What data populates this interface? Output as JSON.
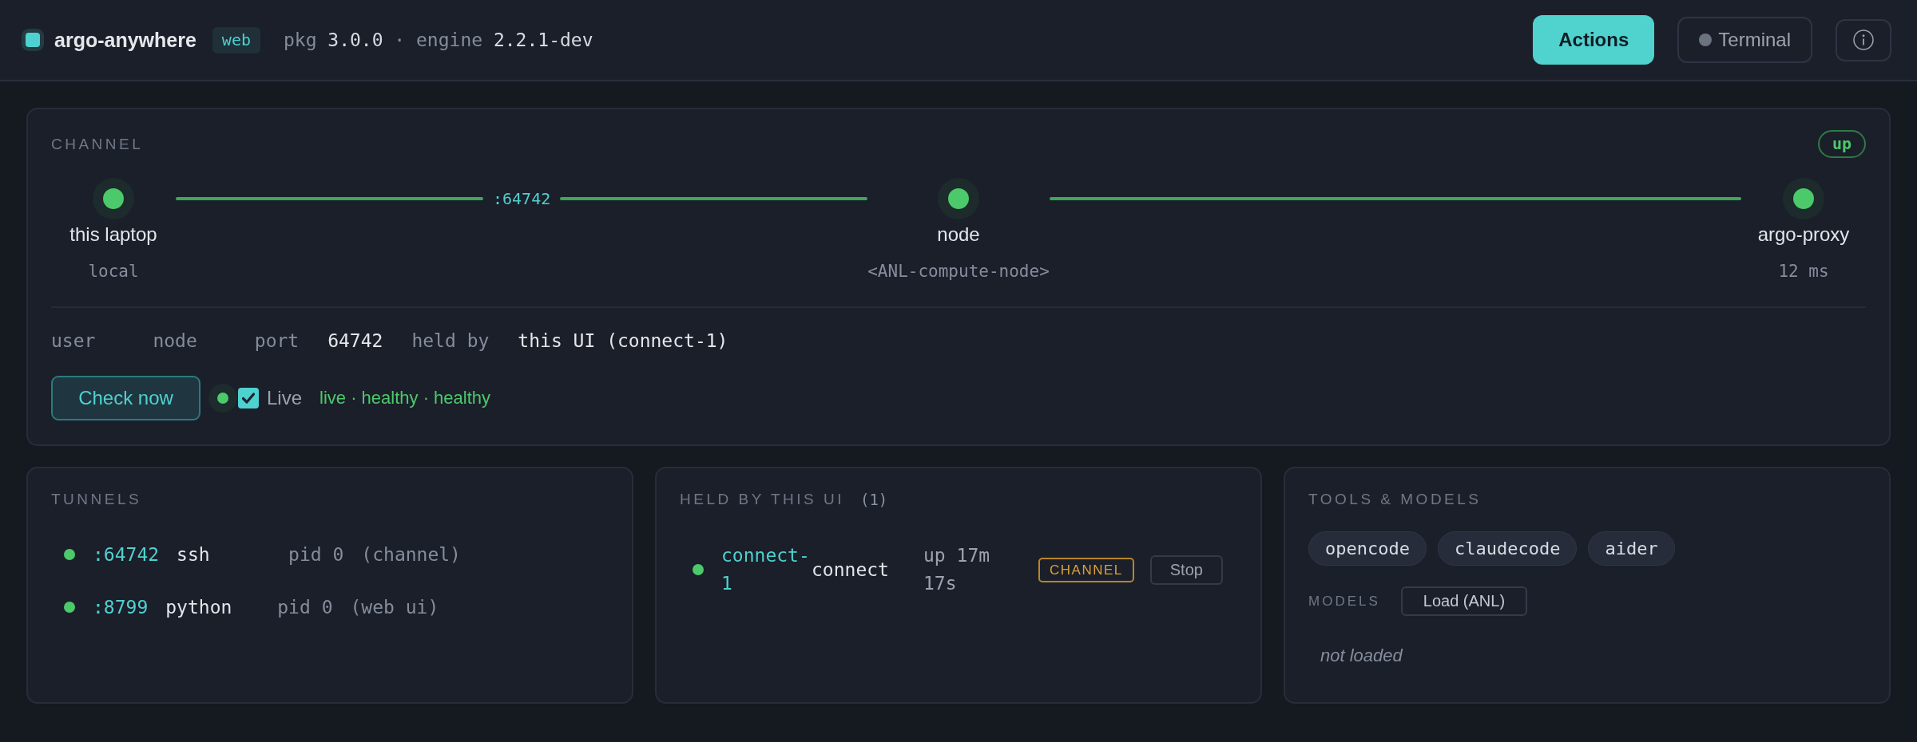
{
  "header": {
    "app_name": "argo-anywhere",
    "badge": "web",
    "versions": [
      {
        "label": "pkg",
        "value": "3.0.0"
      },
      {
        "label": "engine",
        "value": "2.2.1-dev"
      }
    ],
    "separator": "·",
    "buttons": [
      {
        "kind": "primary",
        "label": "Actions"
      },
      {
        "kind": "status",
        "label": "Terminal",
        "running": false
      },
      {
        "kind": "info"
      }
    ]
  },
  "channel": {
    "title": "CHANNEL",
    "status": "up",
    "nodes": [
      {
        "name": "this laptop",
        "detail": "local",
        "up": true
      },
      {
        "name": "node",
        "detail": "<ANL-compute-node>",
        "up": true
      },
      {
        "name": "argo-proxy",
        "detail": "12 ms",
        "up": true
      }
    ],
    "links": [
      {
        "label": ":64742",
        "up": true
      },
      {
        "up": true
      }
    ],
    "fields": [
      {
        "label": "user"
      },
      {
        "label": "node"
      },
      {
        "label": "port",
        "value": "64742"
      },
      {
        "label": "held by",
        "value": "this UI (connect-1)"
      }
    ],
    "check_button": "Check now",
    "live": {
      "healthy": true,
      "checked": true,
      "label": "Live",
      "status": "live · healthy · healthy"
    }
  },
  "tunnels": {
    "title": "TUNNELS",
    "rows": [
      {
        "port": ":64742",
        "process": "ssh",
        "pid": "pid 0",
        "role": "(channel)",
        "up": true
      },
      {
        "port": ":8799",
        "process": "python",
        "pid": "pid 0",
        "role": "(web ui)",
        "up": true
      }
    ]
  },
  "held": {
    "title": "HELD BY THIS UI",
    "count": "(1)",
    "rows": [
      {
        "id": "connect-1",
        "mode": "connect",
        "uptime": "up 17m 17s",
        "tag": "CHANNEL",
        "action": "Stop",
        "up": true
      }
    ]
  },
  "tools": {
    "title": "TOOLS & MODELS",
    "items": [
      "opencode",
      "claudecode",
      "aider"
    ],
    "models_label": "MODELS",
    "load_button": "Load (ANL)",
    "models_status": "not loaded"
  }
}
